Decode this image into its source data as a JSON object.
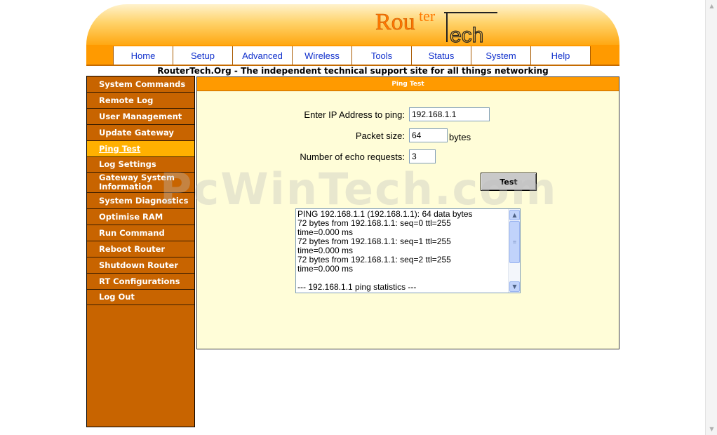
{
  "logo": {
    "text_top": "Router",
    "text_bottom": "Tech"
  },
  "nav": {
    "items": [
      "Home",
      "Setup",
      "Advanced",
      "Wireless",
      "Tools",
      "Status",
      "System",
      "Help"
    ]
  },
  "tagline": "RouterTech.Org - The independent technical support site for all things networking",
  "sidebar": {
    "items": [
      "System Commands",
      "Remote Log",
      "User Management",
      "Update Gateway",
      "Ping Test",
      "Log Settings",
      "Gateway System Information",
      "System Diagnostics",
      "Optimise RAM",
      "Run Command",
      "Reboot Router",
      "Shutdown Router",
      "RT Configurations",
      "Log Out"
    ],
    "active": "Ping Test"
  },
  "panel": {
    "title": "Ping Test",
    "ip_label": "Enter IP Address to ping:",
    "ip_value": "192.168.1.1",
    "size_label": "Packet size:",
    "size_value": "64",
    "size_unit": "bytes",
    "count_label": "Number of echo requests:",
    "count_value": "3",
    "test_button": "Test",
    "output": "PING 192.168.1.1 (192.168.1.1): 64 data bytes\n72 bytes from 192.168.1.1: seq=0 ttl=255\ntime=0.000 ms\n72 bytes from 192.168.1.1: seq=1 ttl=255\ntime=0.000 ms\n72 bytes from 192.168.1.1: seq=2 ttl=255\ntime=0.000 ms\n\n--- 192.168.1.1 ping statistics ---"
  },
  "watermark": "PcWinTech.com",
  "colors": {
    "orange": "#ff9a00",
    "sidebar": "#c86400",
    "active_item": "#ffb000",
    "panel_bg": "#fffdd8",
    "nav_link": "#1030cc"
  }
}
